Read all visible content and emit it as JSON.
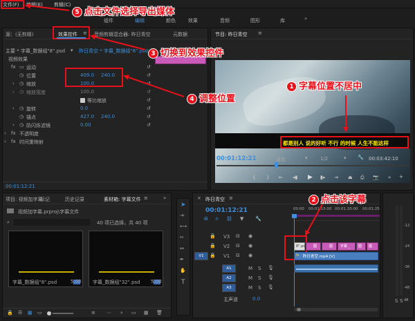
{
  "menu": {
    "file": "文件(F)",
    "edit": "编辑(E)",
    "clip": "剪辑(C)"
  },
  "workspaces": [
    "组件",
    "编辑",
    "颜色",
    "效果",
    "音频",
    "图形",
    "库"
  ],
  "source_panel": {
    "tab": "源：(无剪辑)",
    "effect_controls_tab": "效果控件",
    "mixer_tab": "音频剪辑混合器: 昨日青空",
    "meta_tab": "元数据"
  },
  "effect_controls": {
    "clip_path": "主要 * 字幕_数据组\"8\".psd",
    "seq_path": "昨日青空 * 字幕_数据组\"8\".psd",
    "section": "视频效果",
    "motion": "运动",
    "position_label": "位置",
    "position_x": "409.0",
    "position_y": "240.0",
    "scale_label": "缩放",
    "scale_value": "100.0",
    "scale_width_label": "缩放宽度",
    "scale_width_value": "100.0",
    "uniform_label": "等比缩放",
    "rotation_label": "旋转",
    "rotation_value": "0.0",
    "anchor_label": "锚点",
    "anchor_x": "427.0",
    "anchor_y": "240.0",
    "antiflicker_label": "防闪烁滤镜",
    "antiflicker_value": "0.00",
    "opacity_label": "不透明度",
    "timeremap_label": "时间重映射",
    "timecode": "00:01:12:21"
  },
  "program": {
    "title": "节目: 昨日青空",
    "timecode": "00:01:12:21",
    "fit": "适合",
    "quality": "1/2",
    "duration": "00:03:42:10",
    "subtitle": "都是别人 说的好听 不行 的时候 人生不能这样"
  },
  "project": {
    "tabs": [
      "项目: 视频加字幕",
      "标记",
      "历史记录",
      "素材箱: 字幕文件"
    ],
    "path": "视频加字幕.prproj\\字幕文件",
    "count": "40 项已选择，共 40 项",
    "thumb1_name": "字幕_数据组\"8\".psd",
    "thumb1_dur": "5:00",
    "thumb2_name": "字幕_数据组\"32\".psd",
    "thumb2_dur": "5:00"
  },
  "timeline": {
    "title": "昨日青空",
    "timecode": "00:01:12:21",
    "ruler": [
      "00:00",
      "00:01:15:00",
      "00:01:20:00",
      "00:01:25"
    ],
    "tracks": [
      "V3",
      "V2",
      "V1",
      "A1",
      "A2",
      "A3",
      "主声道"
    ],
    "v1_src": "V1",
    "master_value": "0.0",
    "clip_v2_first": "8\".psd",
    "clip_v1": "昨日青空.mp4 [V]",
    "v2_clip_labels": [
      "图",
      "图",
      "字幕 _",
      "图",
      "图"
    ]
  },
  "meter": {
    "labels": [
      "S",
      "S"
    ],
    "scale": [
      "-12",
      "-24",
      "-36",
      "-48",
      "dB"
    ]
  },
  "annotations": {
    "a1": "字幕位置不居中",
    "n1": "1",
    "a2": "点击该字幕",
    "n2": "2",
    "a3": "切换到效果控件",
    "n3": "3",
    "a4": "调整位置",
    "n4": "4",
    "a5": "点击文件选择导出媒体",
    "n5": "5"
  },
  "colors": {
    "accent": "#3d8fdc",
    "annotation": "#e8111b",
    "clip_pink": "#c85bb8",
    "clip_blue": "#4a7fbf"
  }
}
